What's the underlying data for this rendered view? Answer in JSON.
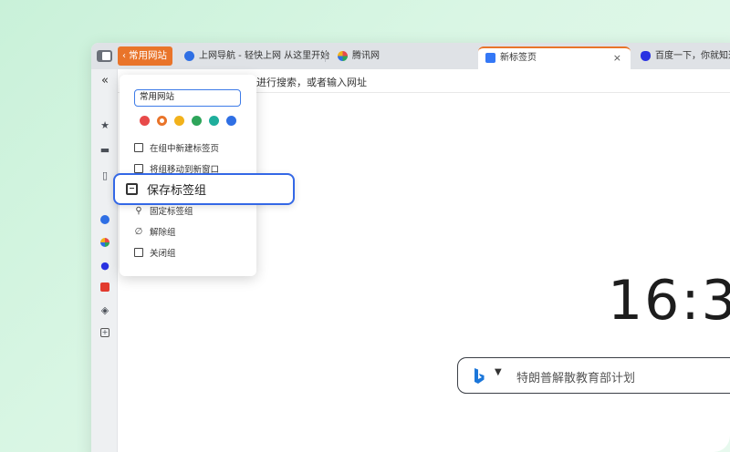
{
  "tabbar": {
    "group_label": "常用网站",
    "tabs": [
      {
        "label": "上网导航 - 轻快上网 从这里开始",
        "icon": "search-logo-icon",
        "color": "#2f6fe4"
      },
      {
        "label": "腾讯网",
        "icon": "tencent-logo-icon",
        "color": "#1e90ff"
      },
      {
        "label": "新标签页",
        "icon": "newtab-icon",
        "color": "#3478f6",
        "active": true
      },
      {
        "label": "百度一下，你就知道",
        "icon": "baidu-paw-icon",
        "color": "#2932e1"
      }
    ],
    "close_glyph": "×"
  },
  "address": {
    "text": "进行搜索，或者输入网址"
  },
  "group_menu": {
    "name_value": "常用网站",
    "colors": [
      "#e84a4a",
      "#e9742a",
      "#f2b21b",
      "#2ea55a",
      "#1fae9c",
      "#2f6fe4"
    ],
    "selected_color": "#e9742a",
    "items": [
      {
        "label": "在组中新建标签页",
        "icon": "new-tab-in-group-icon"
      },
      {
        "label": "将组移动到新窗口",
        "icon": "move-group-icon"
      },
      {
        "label": "固定标签组",
        "icon": "pin-icon"
      },
      {
        "label": "解除组",
        "icon": "ungroup-icon"
      },
      {
        "label": "关闭组",
        "icon": "close-group-icon"
      }
    ],
    "highlighted": {
      "label": "保存标签组",
      "icon": "save-group-icon"
    }
  },
  "newtab": {
    "clock": "16:3",
    "search_placeholder": "特朗普解散教育部计划"
  }
}
